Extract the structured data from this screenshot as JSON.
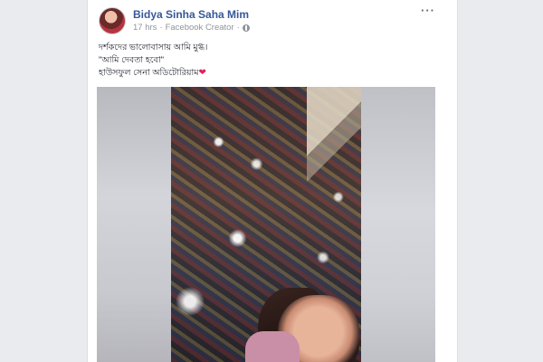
{
  "post": {
    "author": "Bidya Sinha Saha Mim",
    "time": "17 hrs",
    "separator": "·",
    "role": "Facebook Creator",
    "role_separator": "·",
    "privacy_icon": "globe-icon",
    "more_icon": "more-options-icon",
    "text_lines": [
      "দর্শকদের ভালোবাসায় আমি মুগ্ধ।",
      "\"আমি দেবতা হবো\"",
      "হাউসফুল সেনা অডিটোরিয়াম"
    ],
    "trailing_emoji": "❤"
  },
  "media": {
    "type": "video",
    "description_icon": "video-thumbnail"
  },
  "colors": {
    "background": "#e9ebee",
    "author_link": "#365899",
    "meta_text": "#90949c",
    "heart": "#e0245e"
  }
}
